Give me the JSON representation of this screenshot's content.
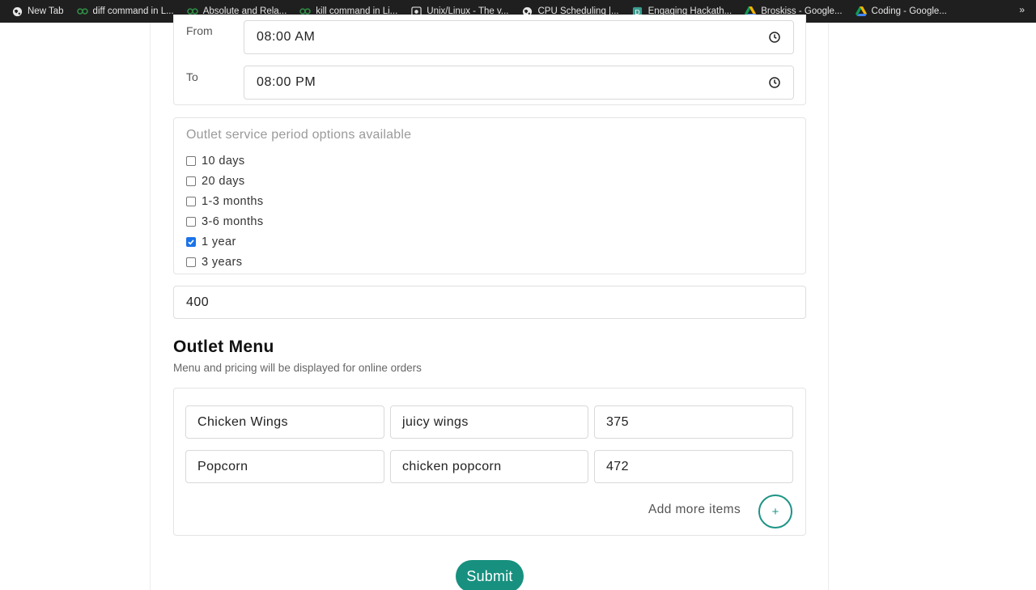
{
  "bookmarks": [
    {
      "label": "New Tab",
      "icon": "globe-icon"
    },
    {
      "label": "diff command in L...",
      "icon": "gfg-icon"
    },
    {
      "label": "Absolute and Rela...",
      "icon": "gfg-icon"
    },
    {
      "label": "kill command in Li...",
      "icon": "gfg-icon"
    },
    {
      "label": "Unix/Linux - The v...",
      "icon": "tutorialspoint-icon"
    },
    {
      "label": "CPU Scheduling |...",
      "icon": "globe-icon"
    },
    {
      "label": "Engaging Hackath...",
      "icon": "devfolio-icon"
    },
    {
      "label": "Broskiss - Google...",
      "icon": "drive-icon"
    },
    {
      "label": "Coding - Google...",
      "icon": "drive-icon"
    }
  ],
  "overflow": "»",
  "timing": {
    "from_label": "From",
    "from_value": "08:00 AM",
    "to_label": "To",
    "to_value": "08:00 PM"
  },
  "service": {
    "title": "Outlet service period options available",
    "options": [
      {
        "label": "10 days",
        "checked": false
      },
      {
        "label": "20 days",
        "checked": false
      },
      {
        "label": "1-3 months",
        "checked": false
      },
      {
        "label": "3-6 months",
        "checked": false
      },
      {
        "label": "1 year",
        "checked": true
      },
      {
        "label": "3 years",
        "checked": false
      }
    ]
  },
  "price_value": "400",
  "menu": {
    "title": "Outlet Menu",
    "subtitle": "Menu and pricing will be displayed for online orders",
    "items": [
      {
        "name": "Chicken Wings",
        "description": "juicy wings",
        "price": "375"
      },
      {
        "name": "Popcorn",
        "description": "chicken popcorn",
        "price": "472"
      }
    ],
    "add_more_label": "Add more items",
    "add_button_label": "+"
  },
  "submit_label": "Submit",
  "colors": {
    "accent": "#17907f",
    "checkbox": "#1a73e8",
    "bookmarks_bg": "#1f1f1f"
  }
}
